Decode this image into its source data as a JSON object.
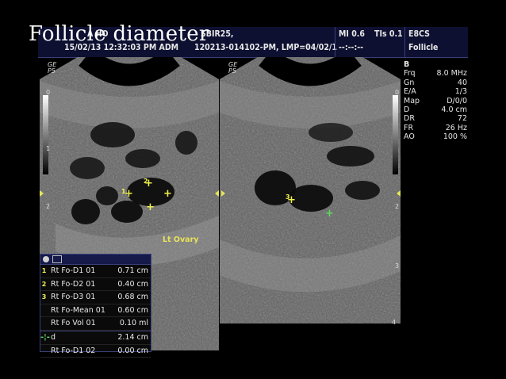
{
  "slide_title": "Follicle   diameter",
  "header": {
    "hospital": "A HO",
    "datetime": "15/02/13 12:32:03 PM ADM",
    "patient_name": "SBIR25,",
    "patient_id": "120213-014102-PM, LMP=04/02/1",
    "mi": "MI 0.6",
    "tis": "TIs 0.1",
    "blank": "--:--:--",
    "probe": "E8CS",
    "preset": "Follicle"
  },
  "logo": {
    "left": "GE",
    "left_sub": "P5",
    "right": "GE",
    "right_sub": "P5"
  },
  "params": {
    "mode": "B",
    "rows": [
      {
        "k": "Frq",
        "v": "8.0 MHz"
      },
      {
        "k": "Gn",
        "v": "40"
      },
      {
        "k": "E/A",
        "v": "1/3"
      },
      {
        "k": "Map",
        "v": "D/0/0"
      },
      {
        "k": "D",
        "v": "4.0 cm"
      },
      {
        "k": "DR",
        "v": "72"
      },
      {
        "k": "FR",
        "v": "26 Hz"
      },
      {
        "k": "AO",
        "v": "100 %"
      }
    ]
  },
  "depth_marks": {
    "d0": "0",
    "d1": "1",
    "d2": "2",
    "d3": "3",
    "d4": "4"
  },
  "annotation": "Lt Ovary",
  "markers": {
    "m1": "1",
    "m2": "2",
    "m3": "3"
  },
  "measurements": [
    {
      "idx": "1",
      "label": "Rt  Fo-D1 01",
      "value": "0.71 cm"
    },
    {
      "idx": "2",
      "label": "Rt  Fo-D2 01",
      "value": "0.40 cm"
    },
    {
      "idx": "3",
      "label": "Rt  Fo-D3 01",
      "value": "0.68 cm"
    },
    {
      "idx": "",
      "label": "Rt  Fo-Mean 01",
      "value": "0.60 cm"
    },
    {
      "idx": "",
      "label": "Rt  Fo Vol 01",
      "value": "0.10 ml"
    },
    {
      "idx": "",
      "label": "d",
      "value": "2.14 cm"
    },
    {
      "idx": "",
      "label": "Rt  Fo-D1 02",
      "value": "0.00 cm"
    }
  ],
  "colors": {
    "header_bg": "#0d1030",
    "caliper_yellow": "#f0f04e",
    "caliper_green": "#5ddc5d",
    "label_yellow": "#e8e25a"
  }
}
